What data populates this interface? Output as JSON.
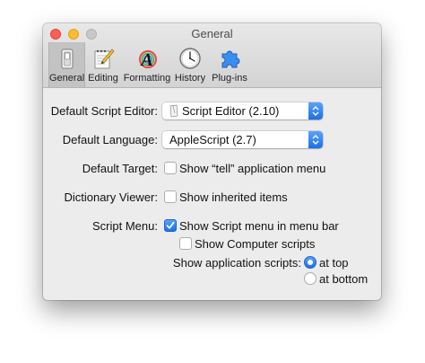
{
  "window": {
    "title": "General"
  },
  "toolbar": {
    "tabs": [
      {
        "label": "General",
        "icon": "general-switch-icon"
      },
      {
        "label": "Editing",
        "icon": "editing-notepad-icon"
      },
      {
        "label": "Formatting",
        "icon": "formatting-letter-icon"
      },
      {
        "label": "History",
        "icon": "history-clock-icon"
      },
      {
        "label": "Plug-ins",
        "icon": "plugins-puzzle-icon"
      }
    ],
    "selected": "General"
  },
  "settings": {
    "default_editor": {
      "label": "Default Script Editor:",
      "value": "Script Editor (2.10)"
    },
    "default_language": {
      "label": "Default Language:",
      "value": "AppleScript (2.7)"
    },
    "default_target": {
      "label": "Default Target:",
      "option": "Show “tell” application menu",
      "checked": false
    },
    "dictionary_viewer": {
      "label": "Dictionary Viewer:",
      "option": "Show inherited items",
      "checked": false
    },
    "script_menu": {
      "label": "Script Menu:",
      "option": "Show Script menu in menu bar",
      "checked": true,
      "computer_scripts": {
        "option": "Show Computer scripts",
        "checked": false
      },
      "app_scripts": {
        "label": "Show application scripts:",
        "options": [
          "at top",
          "at bottom"
        ],
        "selected": "at top"
      }
    }
  },
  "colors": {
    "accent": "#1d6fe9",
    "close": "#fc5d57",
    "minimize": "#fdbc2f",
    "zoom_inactive": "#c8c8c8"
  }
}
